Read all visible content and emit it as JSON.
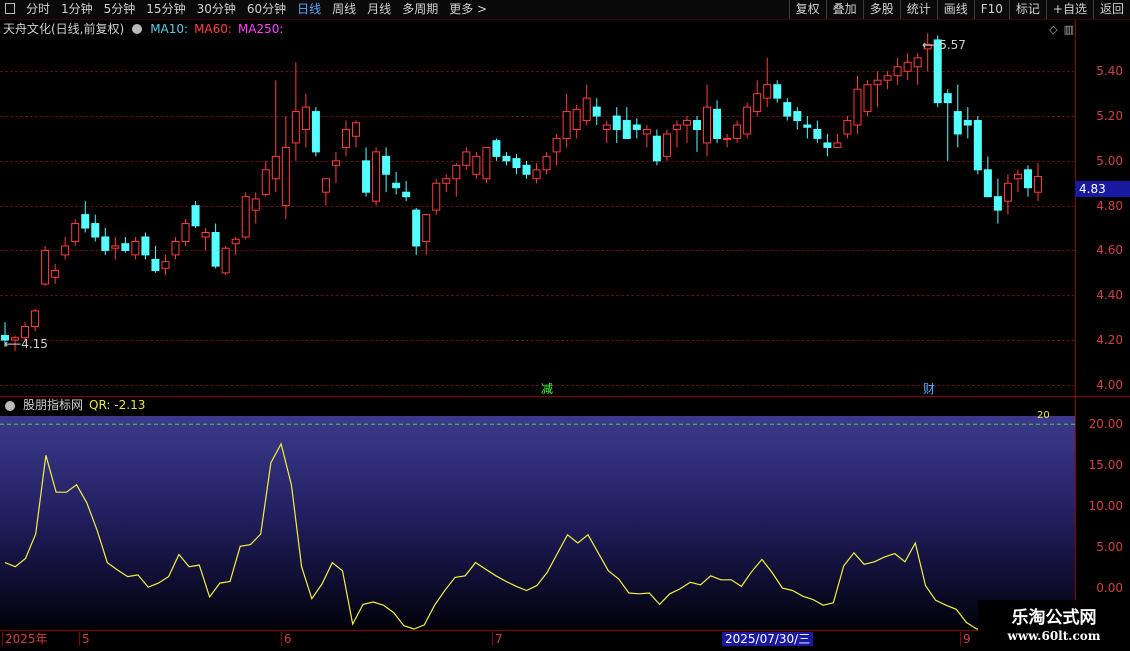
{
  "toolbar": {
    "left": [
      {
        "label": "分时",
        "active": false
      },
      {
        "label": "1分钟",
        "active": false
      },
      {
        "label": "5分钟",
        "active": false
      },
      {
        "label": "15分钟",
        "active": false
      },
      {
        "label": "30分钟",
        "active": false
      },
      {
        "label": "60分钟",
        "active": false
      },
      {
        "label": "日线",
        "active": true
      },
      {
        "label": "周线",
        "active": false
      },
      {
        "label": "月线",
        "active": false
      },
      {
        "label": "多周期",
        "active": false
      },
      {
        "label": "更多 >",
        "active": false
      }
    ],
    "right": [
      "复权",
      "叠加",
      "多股",
      "统计",
      "画线",
      "F10",
      "标记",
      "+自选",
      "返回"
    ]
  },
  "main": {
    "title": "天舟文化(日线,前复权)",
    "ma": [
      {
        "label": "MA10:",
        "color": "#5ec8e8"
      },
      {
        "label": "MA60:",
        "color": "#ff4040"
      },
      {
        "label": "MA250:",
        "color": "#ff40ff"
      }
    ],
    "current_price": "4.83",
    "high_label": "5.57",
    "low_label": "4.15",
    "price_ticks": [
      "5.40",
      "5.20",
      "5.00",
      "4.80",
      "4.60",
      "4.40",
      "4.20",
      "4.00"
    ],
    "markers": [
      {
        "text": "减",
        "color": "#40ff40"
      },
      {
        "text": "财",
        "color": "#5aa9ff"
      }
    ]
  },
  "sub": {
    "title": "股朋指标网",
    "qr": "QR: -2.13",
    "ref_label": "20",
    "ticks": [
      "20.00",
      "15.00",
      "10.00",
      "5.00",
      "0.00"
    ]
  },
  "date_axis": {
    "labels": [
      "2025年",
      "5",
      "6",
      "7",
      "9"
    ],
    "cursor": "2025/07/30/三"
  },
  "watermark": {
    "line1": "乐淘公式网",
    "line2": "www.60lt.com"
  },
  "chart_data": [
    {
      "type": "candlestick",
      "title": "天舟文化(日线,前复权)",
      "ylim": [
        3.95,
        5.62
      ],
      "ohlc": [
        [
          4.22,
          4.28,
          4.17,
          4.2
        ],
        [
          4.2,
          4.22,
          4.15,
          4.21
        ],
        [
          4.21,
          4.28,
          4.2,
          4.26
        ],
        [
          4.26,
          4.34,
          4.24,
          4.33
        ],
        [
          4.45,
          4.62,
          4.44,
          4.6
        ],
        [
          4.48,
          4.54,
          4.45,
          4.51
        ],
        [
          4.58,
          4.66,
          4.56,
          4.62
        ],
        [
          4.64,
          4.74,
          4.62,
          4.72
        ],
        [
          4.76,
          4.82,
          4.68,
          4.7
        ],
        [
          4.72,
          4.76,
          4.64,
          4.66
        ],
        [
          4.66,
          4.7,
          4.58,
          4.6
        ],
        [
          4.61,
          4.66,
          4.56,
          4.62
        ],
        [
          4.63,
          4.66,
          4.59,
          4.6
        ],
        [
          4.58,
          4.66,
          4.56,
          4.64
        ],
        [
          4.66,
          4.68,
          4.56,
          4.58
        ],
        [
          4.56,
          4.62,
          4.5,
          4.51
        ],
        [
          4.52,
          4.58,
          4.49,
          4.55
        ],
        [
          4.58,
          4.66,
          4.56,
          4.64
        ],
        [
          4.64,
          4.74,
          4.62,
          4.72
        ],
        [
          4.8,
          4.82,
          4.7,
          4.71
        ],
        [
          4.66,
          4.7,
          4.6,
          4.68
        ],
        [
          4.68,
          4.72,
          4.52,
          4.53
        ],
        [
          4.5,
          4.62,
          4.49,
          4.61
        ],
        [
          4.63,
          4.66,
          4.58,
          4.65
        ],
        [
          4.66,
          4.86,
          4.65,
          4.84
        ],
        [
          4.78,
          4.86,
          4.72,
          4.83
        ],
        [
          4.85,
          5.0,
          4.84,
          4.96
        ],
        [
          4.92,
          5.36,
          4.86,
          5.02
        ],
        [
          4.8,
          5.2,
          4.74,
          5.06
        ],
        [
          5.08,
          5.44,
          5.0,
          5.22
        ],
        [
          5.14,
          5.3,
          5.06,
          5.24
        ],
        [
          5.22,
          5.24,
          5.02,
          5.04
        ],
        [
          4.86,
          4.9,
          4.8,
          4.92
        ],
        [
          4.98,
          5.04,
          4.9,
          5.0
        ],
        [
          5.06,
          5.18,
          5.02,
          5.14
        ],
        [
          5.11,
          5.18,
          5.06,
          5.17
        ],
        [
          5.0,
          5.06,
          4.84,
          4.86
        ],
        [
          4.82,
          5.06,
          4.8,
          5.04
        ],
        [
          5.02,
          5.06,
          4.86,
          4.94
        ],
        [
          4.9,
          4.95,
          4.85,
          4.88
        ],
        [
          4.86,
          4.91,
          4.82,
          4.84
        ],
        [
          4.78,
          4.79,
          4.58,
          4.62
        ],
        [
          4.64,
          4.76,
          4.58,
          4.76
        ],
        [
          4.78,
          4.92,
          4.76,
          4.9
        ],
        [
          4.9,
          4.94,
          4.86,
          4.92
        ],
        [
          4.92,
          4.99,
          4.84,
          4.98
        ],
        [
          4.98,
          5.06,
          4.96,
          5.04
        ],
        [
          4.94,
          5.04,
          4.92,
          5.02
        ],
        [
          4.92,
          5.06,
          4.9,
          5.06
        ],
        [
          5.09,
          5.1,
          5.0,
          5.02
        ],
        [
          5.02,
          5.04,
          4.98,
          5.0
        ],
        [
          5.01,
          5.03,
          4.94,
          4.97
        ],
        [
          4.98,
          5.0,
          4.92,
          4.94
        ],
        [
          4.92,
          4.99,
          4.9,
          4.96
        ],
        [
          4.96,
          5.04,
          4.94,
          5.02
        ],
        [
          5.04,
          5.12,
          4.98,
          5.1
        ],
        [
          5.1,
          5.3,
          5.06,
          5.22
        ],
        [
          5.14,
          5.25,
          5.1,
          5.23
        ],
        [
          5.18,
          5.34,
          5.16,
          5.28
        ],
        [
          5.24,
          5.28,
          5.16,
          5.2
        ],
        [
          5.14,
          5.18,
          5.08,
          5.16
        ],
        [
          5.2,
          5.24,
          5.08,
          5.14
        ],
        [
          5.18,
          5.24,
          5.1,
          5.1
        ],
        [
          5.16,
          5.19,
          5.1,
          5.14
        ],
        [
          5.12,
          5.16,
          5.06,
          5.14
        ],
        [
          5.11,
          5.14,
          4.98,
          5.0
        ],
        [
          5.02,
          5.14,
          5.0,
          5.12
        ],
        [
          5.14,
          5.18,
          5.06,
          5.16
        ],
        [
          5.16,
          5.2,
          5.08,
          5.18
        ],
        [
          5.18,
          5.2,
          5.04,
          5.14
        ],
        [
          5.08,
          5.34,
          5.02,
          5.24
        ],
        [
          5.23,
          5.27,
          5.08,
          5.1
        ],
        [
          5.1,
          5.12,
          5.06,
          5.1
        ],
        [
          5.1,
          5.18,
          5.08,
          5.16
        ],
        [
          5.12,
          5.26,
          5.1,
          5.24
        ],
        [
          5.22,
          5.36,
          5.2,
          5.3
        ],
        [
          5.28,
          5.46,
          5.24,
          5.34
        ],
        [
          5.34,
          5.36,
          5.26,
          5.28
        ],
        [
          5.26,
          5.28,
          5.18,
          5.2
        ],
        [
          5.22,
          5.24,
          5.14,
          5.18
        ],
        [
          5.16,
          5.2,
          5.1,
          5.15
        ],
        [
          5.14,
          5.18,
          5.08,
          5.1
        ],
        [
          5.08,
          5.12,
          5.02,
          5.06
        ],
        [
          5.06,
          5.12,
          5.06,
          5.08
        ],
        [
          5.12,
          5.2,
          5.1,
          5.18
        ],
        [
          5.16,
          5.38,
          5.12,
          5.32
        ],
        [
          5.22,
          5.36,
          5.2,
          5.34
        ],
        [
          5.34,
          5.4,
          5.24,
          5.36
        ],
        [
          5.36,
          5.4,
          5.32,
          5.38
        ],
        [
          5.38,
          5.46,
          5.34,
          5.42
        ],
        [
          5.4,
          5.48,
          5.36,
          5.44
        ],
        [
          5.42,
          5.48,
          5.34,
          5.46
        ],
        [
          5.5,
          5.57,
          5.4,
          5.52
        ],
        [
          5.54,
          5.56,
          5.24,
          5.26
        ],
        [
          5.3,
          5.32,
          5.0,
          5.26
        ],
        [
          5.22,
          5.34,
          5.06,
          5.12
        ],
        [
          5.18,
          5.24,
          5.1,
          5.16
        ],
        [
          5.18,
          5.2,
          4.94,
          4.96
        ],
        [
          4.96,
          5.02,
          4.84,
          4.84
        ],
        [
          4.84,
          4.92,
          4.72,
          4.78
        ],
        [
          4.82,
          4.94,
          4.76,
          4.9
        ],
        [
          4.92,
          4.96,
          4.86,
          4.94
        ],
        [
          4.96,
          4.98,
          4.84,
          4.88
        ],
        [
          4.86,
          4.99,
          4.82,
          4.93
        ]
      ]
    },
    {
      "type": "line",
      "title": "股朋指标网 QR",
      "ylim": [
        -5,
        21
      ],
      "series": [
        {
          "name": "QR",
          "values": [
            3.1,
            2.6,
            3.6,
            6.6,
            16.2,
            11.7,
            11.7,
            12.6,
            10.4,
            7.1,
            3.1,
            2.2,
            1.4,
            1.6,
            0.1,
            0.6,
            1.4,
            4.1,
            2.6,
            2.8,
            -1.1,
            0.6,
            0.8,
            5.1,
            5.3,
            6.6,
            15.3,
            17.6,
            12.6,
            2.6,
            -1.3,
            0.5,
            3.1,
            2.1,
            -4.4,
            -2.0,
            -1.7,
            -2.1,
            -3.0,
            -4.6,
            -6.4,
            -4.5,
            -2.1,
            -0.3,
            1.3,
            1.5,
            3.1,
            2.3,
            1.5,
            0.8,
            0.2,
            -0.3,
            0.3,
            1.9,
            4.2,
            6.5,
            5.5,
            6.5,
            4.3,
            2.1,
            1.1,
            -0.6,
            -0.7,
            -0.6,
            -2.0,
            -0.7,
            -0.1,
            0.7,
            0.4,
            1.5,
            1.0,
            1.0,
            0.2,
            2.0,
            3.5,
            1.9,
            0.0,
            -0.3,
            -1.0,
            -1.4,
            -2.1,
            -1.8,
            2.7,
            4.3,
            2.9,
            3.2,
            3.8,
            4.2,
            3.2,
            5.5,
            0.3,
            -1.5,
            -2.1,
            -2.6,
            -4.2,
            -6.9,
            -6.7,
            -6.9,
            -4.0,
            -3.6,
            -3.7,
            -2.1
          ]
        }
      ],
      "reference_line": 20
    }
  ]
}
